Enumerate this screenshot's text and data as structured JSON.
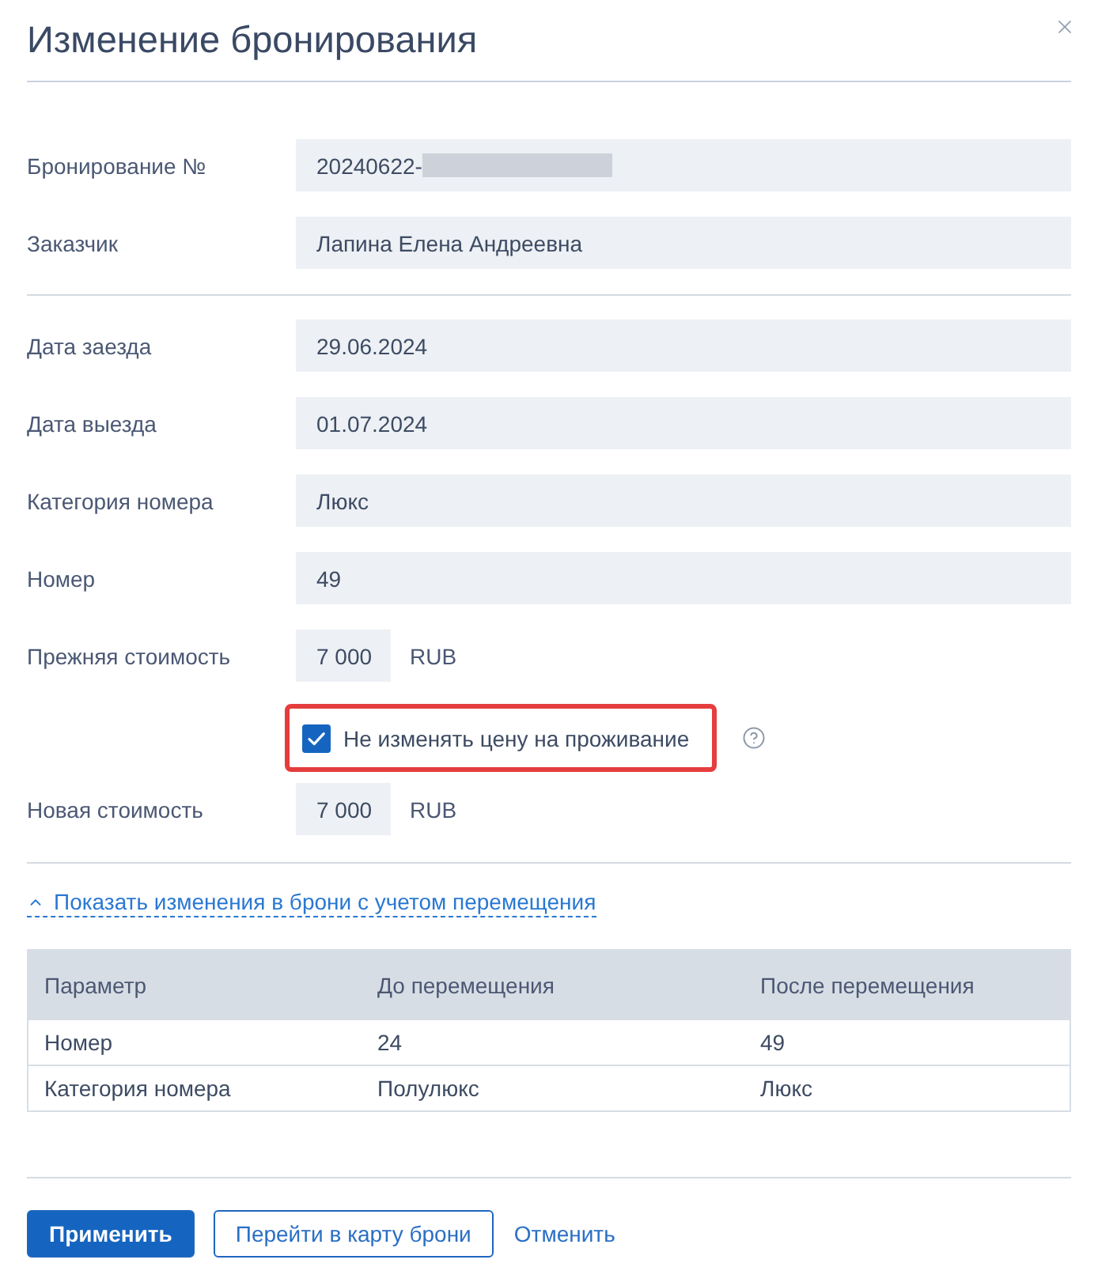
{
  "dialog": {
    "title": "Изменение бронирования"
  },
  "customer_fields": [
    {
      "label": "Бронирование №",
      "value": "20240622-",
      "redacted": true
    },
    {
      "label": "Заказчик",
      "value": "Лапина Елена Андреевна",
      "redacted": false
    }
  ],
  "stay_fields": [
    {
      "kind": "text",
      "label": "Дата заезда",
      "value": "29.06.2024"
    },
    {
      "kind": "text",
      "label": "Дата выезда",
      "value": "01.07.2024"
    },
    {
      "kind": "text",
      "label": "Категория номера",
      "value": "Люкс"
    },
    {
      "kind": "text",
      "label": "Номер",
      "value": "49"
    },
    {
      "kind": "price",
      "label": "Прежняя стоимость",
      "value": "7 000",
      "currency": "RUB"
    },
    {
      "kind": "checkbox",
      "label": "Не изменять цену на проживание",
      "checked": true,
      "highlighted": true,
      "help": true
    },
    {
      "kind": "price",
      "label": "Новая стоимость",
      "value": "7 000",
      "currency": "RUB"
    }
  ],
  "changes": {
    "toggle": "Показать изменения в брони с учетом перемещения",
    "expanded": true,
    "table": {
      "columns": [
        "Параметр",
        "До перемещения",
        "После перемещения"
      ],
      "rows": [
        [
          "Номер",
          "24",
          "49"
        ],
        [
          "Категория номера",
          "Полулюкс",
          "Люкс"
        ]
      ]
    }
  },
  "buttons": [
    {
      "kind": "primary",
      "label": "Применить"
    },
    {
      "kind": "outline",
      "label": "Перейти в карту брони"
    },
    {
      "kind": "link",
      "label": "Отменить"
    }
  ]
}
